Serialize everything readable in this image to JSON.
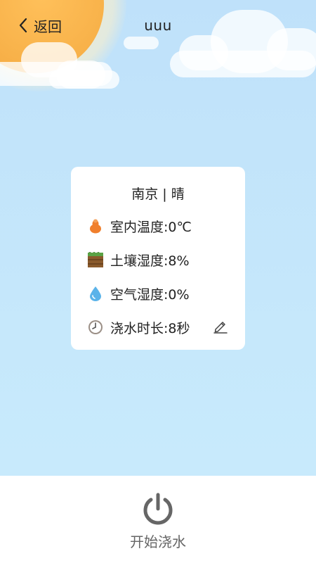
{
  "header": {
    "back_label": "返回",
    "title": "uuu"
  },
  "card": {
    "location": "南京 | 晴",
    "rows": [
      {
        "icon": "thermometer-drop-icon",
        "text": "室内温度:0℃"
      },
      {
        "icon": "soil-icon",
        "text": "土壤湿度:8%"
      },
      {
        "icon": "water-drop-icon",
        "text": "空气湿度:0%"
      },
      {
        "icon": "clock-icon",
        "text": "浇水时长:8秒"
      }
    ],
    "edit_icon": "edit-pencil-icon"
  },
  "bottom": {
    "power_icon": "power-icon",
    "start_label": "开始浇水"
  },
  "colors": {
    "sky_top": "#bfe1fa",
    "sky_bottom": "#c9ecfd",
    "sun": "#f8b24a",
    "card_bg": "#ffffff",
    "text": "#222222",
    "power_icon": "#666666"
  }
}
